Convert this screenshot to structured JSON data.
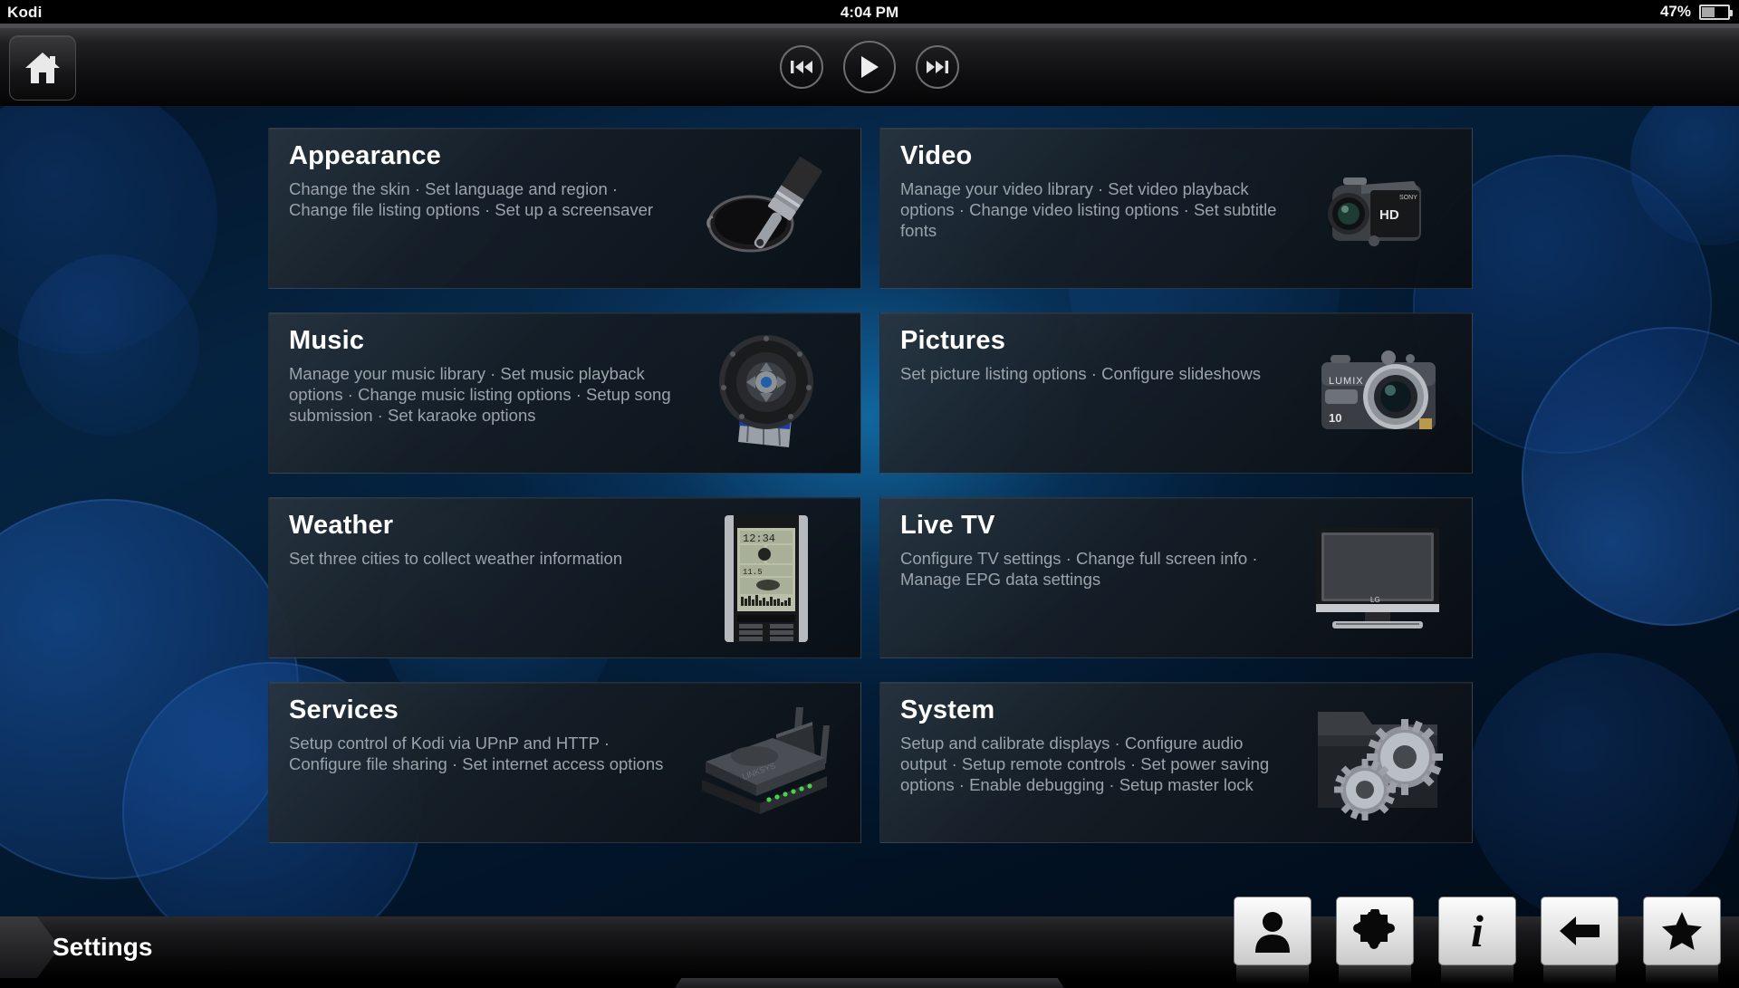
{
  "statusbar": {
    "app_name": "Kodi",
    "clock": "4:04 PM",
    "battery_percent": "47%",
    "battery_level": 47,
    "battery_icon": "battery-icon"
  },
  "topbar": {
    "home_button_label": "Home",
    "home_icon": "home-icon",
    "transport": [
      {
        "name": "rewind-button",
        "icon": "skip-back-icon"
      },
      {
        "name": "play-button",
        "icon": "play-icon"
      },
      {
        "name": "forward-button",
        "icon": "skip-forward-icon"
      }
    ]
  },
  "main": {
    "tiles": [
      {
        "id": "appearance",
        "title": "Appearance",
        "desc": "Change the skin · Set language and region · Change file listing options · Set up a screensaver",
        "icon": "paint-brush-and-can-icon"
      },
      {
        "id": "video",
        "title": "Video",
        "desc": "Manage your video library · Set video playback options · Change video listing options · Set subtitle fonts",
        "icon": "camcorder-icon"
      },
      {
        "id": "music",
        "title": "Music",
        "desc": "Manage your music library · Set music playback options · Change music listing options · Setup song submission · Set karaoke options",
        "icon": "loudspeaker-icon"
      },
      {
        "id": "pictures",
        "title": "Pictures",
        "desc": "Set picture listing options · Configure slideshows",
        "icon": "compact-camera-icon"
      },
      {
        "id": "weather",
        "title": "Weather",
        "desc": "Set three cities to collect weather information",
        "icon": "weather-station-icon"
      },
      {
        "id": "livetv",
        "title": "Live TV",
        "desc": "Configure TV settings · Change full screen info · Manage EPG data settings",
        "icon": "television-icon"
      },
      {
        "id": "services",
        "title": "Services",
        "desc": "Setup control of Kodi via UPnP and HTTP · Configure file sharing · Set internet access options",
        "icon": "wireless-router-icon"
      },
      {
        "id": "system",
        "title": "System",
        "desc": "Setup and calibrate displays · Configure audio output · Setup remote controls · Set power saving options · Enable debugging · Setup master lock",
        "icon": "folder-with-gears-icon"
      }
    ]
  },
  "bottombar": {
    "page_label": "Settings",
    "buttons": [
      {
        "name": "profile-button",
        "icon": "person-icon"
      },
      {
        "name": "addons-button",
        "icon": "puzzle-piece-icon"
      },
      {
        "name": "info-button",
        "icon": "info-icon",
        "glyph": "i"
      },
      {
        "name": "back-button",
        "icon": "arrow-left-icon"
      },
      {
        "name": "favourites-button",
        "icon": "star-icon"
      }
    ]
  },
  "colors": {
    "accent_glow": "#1a96dc",
    "bokeh": "#1450a0",
    "tile_border": "rgba(120,140,160,0.22)",
    "title_text": "#ffffff",
    "desc_text": "#9ba3ab"
  }
}
